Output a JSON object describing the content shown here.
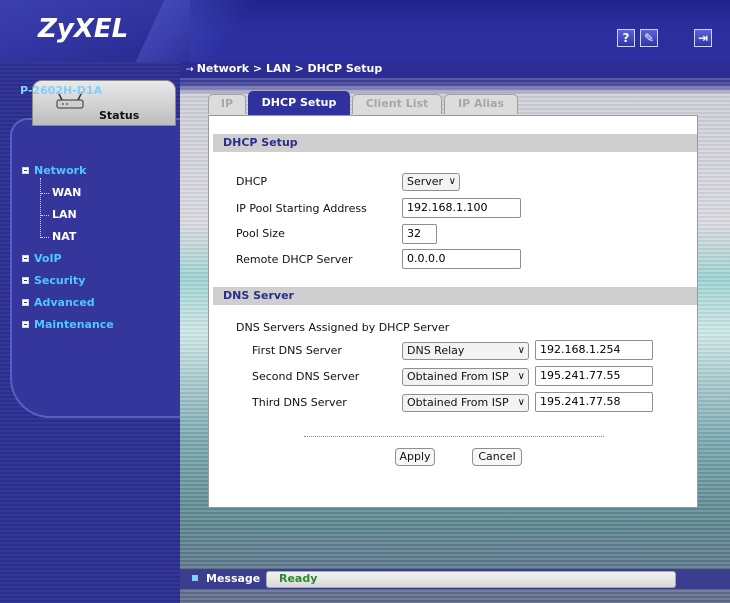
{
  "header": {
    "logo": "ZyXEL",
    "help_label": "?",
    "wizard_label": "✎",
    "logout_label": "⇥"
  },
  "sidebar": {
    "status_label": "Status",
    "device_name": "P-2602H-D1A",
    "network_label": "Network",
    "network_children": [
      "WAN",
      "LAN",
      "NAT"
    ],
    "items": [
      "VoIP",
      "Security",
      "Advanced",
      "Maintenance"
    ]
  },
  "breadcrumb": "Network > LAN > DHCP Setup",
  "tabs": [
    {
      "label": "IP",
      "active": false
    },
    {
      "label": "DHCP Setup",
      "active": true
    },
    {
      "label": "Client List",
      "active": false
    },
    {
      "label": "IP Alias",
      "active": false
    }
  ],
  "dhcp": {
    "section_title": "DHCP Setup",
    "dhcp_label": "DHCP",
    "dhcp_value": "Server",
    "pool_start_label": "IP Pool Starting Address",
    "pool_start_value": "192.168.1.100",
    "pool_size_label": "Pool Size",
    "pool_size_value": "32",
    "remote_label": "Remote DHCP Server",
    "remote_value": "0.0.0.0"
  },
  "dns": {
    "section_title": "DNS Server",
    "assigned_label": "DNS Servers Assigned by DHCP Server",
    "servers": [
      {
        "label": "First DNS Server",
        "mode": "DNS Relay",
        "ip": "192.168.1.254"
      },
      {
        "label": "Second DNS Server",
        "mode": "Obtained From ISP",
        "ip": "195.241.77.55"
      },
      {
        "label": "Third DNS Server",
        "mode": "Obtained From ISP",
        "ip": "195.241.77.58"
      }
    ]
  },
  "buttons": {
    "apply": "Apply",
    "cancel": "Cancel"
  },
  "message": {
    "label": "Message",
    "text": "Ready"
  },
  "colors": {
    "brand_blue": "#2b2e9e",
    "link_cyan": "#4fc8ff",
    "status_green": "#2b8a2b"
  }
}
